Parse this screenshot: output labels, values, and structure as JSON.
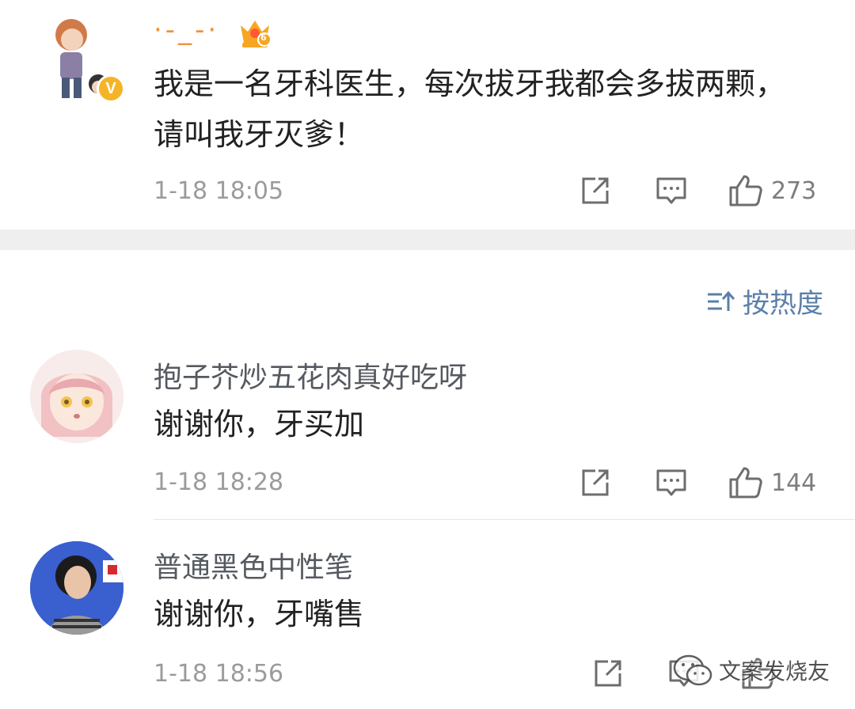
{
  "main_post": {
    "username": "·-_-·",
    "content": "我是一名牙科医生，每次拔牙我都会多拔两颗，请叫我牙灭爹！",
    "timestamp": "1-18 18:05",
    "likes": "273",
    "badge_level": "6"
  },
  "sort": {
    "label": "按热度"
  },
  "comments": [
    {
      "username": "抱子芥炒五花肉真好吃呀",
      "content": "谢谢你，牙买加",
      "timestamp": "1-18 18:28",
      "likes": "144"
    },
    {
      "username": "普通黑色中性笔",
      "content": "谢谢你，牙嘴售",
      "timestamp": "1-18 18:56",
      "likes": ""
    }
  ],
  "watermark": "文案发烧友",
  "icons": {
    "share": "share-icon",
    "reply": "comment-icon",
    "like": "thumbs-up-icon",
    "verified": "verified-badge-icon",
    "crown": "crown-badge-icon",
    "sort": "sort-icon"
  },
  "colors": {
    "sort_blue": "#5b7fa8",
    "verified_yellow": "#f5b428",
    "crown_orange": "#f6a623"
  }
}
